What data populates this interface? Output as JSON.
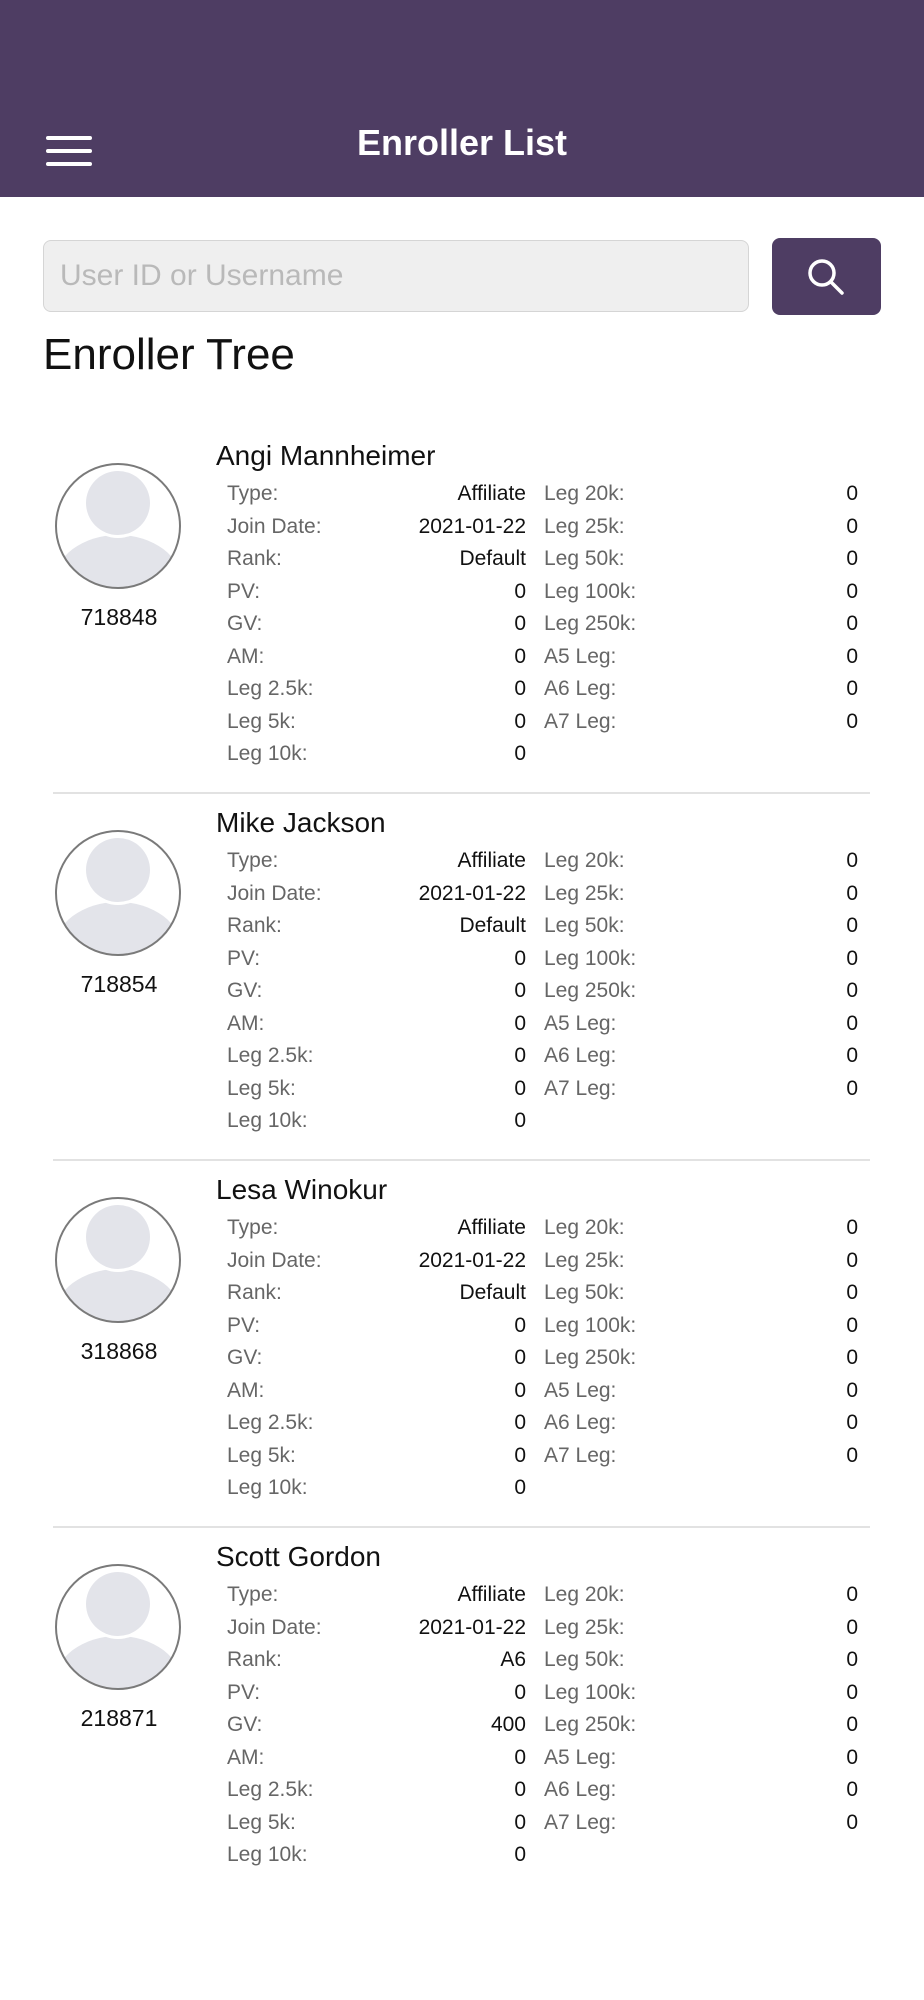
{
  "header": {
    "title": "Enroller List"
  },
  "search": {
    "placeholder": "User ID or Username",
    "value": ""
  },
  "section_title": "Enroller Tree",
  "labels": {
    "type": "Type:",
    "join_date": "Join Date:",
    "rank": "Rank:",
    "pv": "PV:",
    "gv": "GV:",
    "am": "AM:",
    "leg_2_5k": "Leg 2.5k:",
    "leg_5k": "Leg 5k:",
    "leg_10k": "Leg 10k:",
    "leg_20k": "Leg 20k:",
    "leg_25k": "Leg 25k:",
    "leg_50k": "Leg 50k:",
    "leg_100k": "Leg 100k:",
    "leg_250k": "Leg 250k:",
    "a5_leg": "A5 Leg:",
    "a6_leg": "A6 Leg:",
    "a7_leg": "A7 Leg:"
  },
  "members": [
    {
      "name": "Angi Mannheimer",
      "id": "718848",
      "type": "Affiliate",
      "join_date": "2021-01-22",
      "rank": "Default",
      "pv": "0",
      "gv": "0",
      "am": "0",
      "leg_2_5k": "0",
      "leg_5k": "0",
      "leg_10k": "0",
      "leg_20k": "0",
      "leg_25k": "0",
      "leg_50k": "0",
      "leg_100k": "0",
      "leg_250k": "0",
      "a5_leg": "0",
      "a6_leg": "0",
      "a7_leg": "0"
    },
    {
      "name": "Mike Jackson",
      "id": "718854",
      "type": "Affiliate",
      "join_date": "2021-01-22",
      "rank": "Default",
      "pv": "0",
      "gv": "0",
      "am": "0",
      "leg_2_5k": "0",
      "leg_5k": "0",
      "leg_10k": "0",
      "leg_20k": "0",
      "leg_25k": "0",
      "leg_50k": "0",
      "leg_100k": "0",
      "leg_250k": "0",
      "a5_leg": "0",
      "a6_leg": "0",
      "a7_leg": "0"
    },
    {
      "name": "Lesa Winokur",
      "id": "318868",
      "type": "Affiliate",
      "join_date": "2021-01-22",
      "rank": "Default",
      "pv": "0",
      "gv": "0",
      "am": "0",
      "leg_2_5k": "0",
      "leg_5k": "0",
      "leg_10k": "0",
      "leg_20k": "0",
      "leg_25k": "0",
      "leg_50k": "0",
      "leg_100k": "0",
      "leg_250k": "0",
      "a5_leg": "0",
      "a6_leg": "0",
      "a7_leg": "0"
    },
    {
      "name": "Scott Gordon",
      "id": "218871",
      "type": "Affiliate",
      "join_date": "2021-01-22",
      "rank": "A6",
      "pv": "0",
      "gv": "400",
      "am": "0",
      "leg_2_5k": "0",
      "leg_5k": "0",
      "leg_10k": "0",
      "leg_20k": "0",
      "leg_25k": "0",
      "leg_50k": "0",
      "leg_100k": "0",
      "leg_250k": "0",
      "a5_leg": "0",
      "a6_leg": "0",
      "a7_leg": "0"
    }
  ],
  "colors": {
    "brand": "#4e3d63",
    "label": "#666666",
    "divider": "#e2e2e2",
    "avatar_bg": "#e3e4ea"
  },
  "icons": {
    "menu": "hamburger-menu-icon",
    "search": "search-icon",
    "avatar": "user-avatar-icon"
  }
}
